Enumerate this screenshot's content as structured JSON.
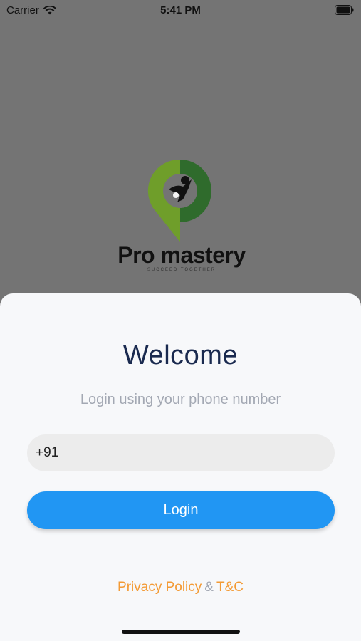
{
  "status_bar": {
    "carrier": "Carrier",
    "time": "5:41 PM"
  },
  "logo": {
    "title": "Pro mastery",
    "tagline": "SUCCEED TOGETHER"
  },
  "login_sheet": {
    "title": "Welcome",
    "subtitle": "Login using your phone number",
    "country_code": "+91",
    "phone_value": "",
    "login_label": "Login",
    "privacy_label": "Privacy Policy",
    "ampersand": "&",
    "terms_label": "T&C"
  },
  "colors": {
    "backdrop": "#747474",
    "title_navy": "#1a2a4f",
    "primary_blue": "#2196f3",
    "link_orange": "#f39a34",
    "logo_green_light": "#6f9e2a",
    "logo_green_dark": "#2f6b2c"
  },
  "icons": [
    "wifi-icon",
    "battery-icon",
    "logo-pin-icon"
  ]
}
